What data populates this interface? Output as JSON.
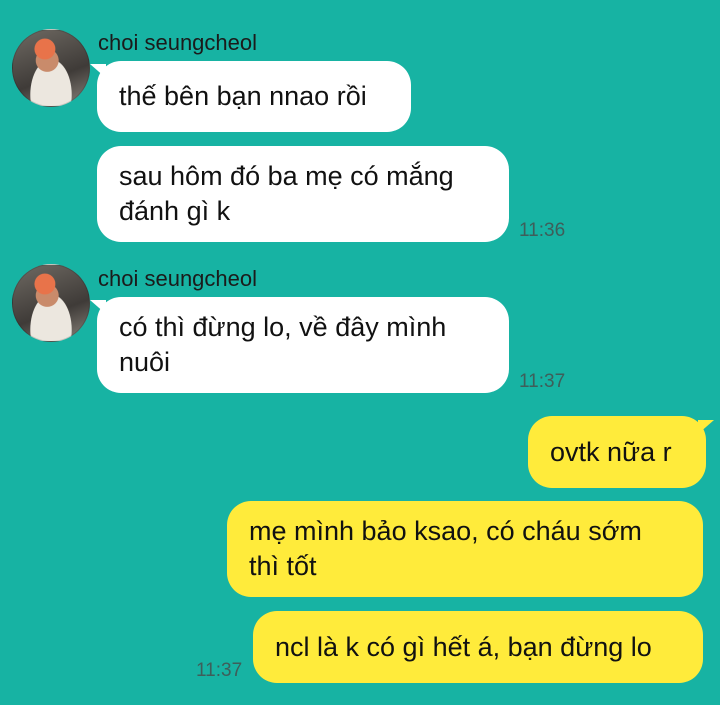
{
  "messages": {
    "group1": {
      "sender": "choi seungcheol",
      "m1": "thế bên bạn nnao rồi",
      "m2": "sau hôm đó ba mẹ có mắng\nđánh gì k",
      "time": "11:36"
    },
    "group2": {
      "sender": "choi seungcheol",
      "m1": "có thì đừng lo, về đây mình\nnuôi",
      "time": "11:37"
    },
    "group3": {
      "m1": "ovtk nữa r",
      "m2": "mẹ mình bảo ksao, có cháu sớm\nthì tốt",
      "m3": "ncl là k có gì hết á, bạn đừng lo",
      "time": "11:37"
    }
  },
  "colors": {
    "background": "#17b3a3",
    "incoming_bubble": "#ffffff",
    "outgoing_bubble": "#ffeb3b"
  }
}
